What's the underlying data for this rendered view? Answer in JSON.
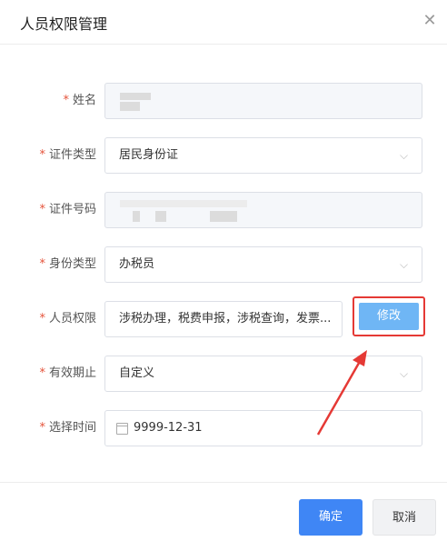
{
  "dialog": {
    "title": "人员权限管理",
    "close_icon": "close-icon"
  },
  "form": {
    "name": {
      "label": "姓名",
      "required": "*"
    },
    "id_type": {
      "label": "证件类型",
      "required": "*",
      "value": "居民身份证"
    },
    "id_number": {
      "label": "证件号码",
      "required": "*"
    },
    "identity_type": {
      "label": "身份类型",
      "required": "*",
      "value": "办税员"
    },
    "permissions": {
      "label": "人员权限",
      "required": "*",
      "value": "涉税办理，税费申报，涉税查询，发票...",
      "edit_label": "修改"
    },
    "validity": {
      "label": "有效期止",
      "required": "*",
      "value": "自定义"
    },
    "select_time": {
      "label": "选择时间",
      "required": "*",
      "value": "9999-12-31"
    }
  },
  "footer": {
    "confirm_label": "确定",
    "cancel_label": "取消"
  },
  "colors": {
    "primary": "#3f86f5",
    "edit_button": "#6fb6f5",
    "highlight": "#e53935"
  }
}
